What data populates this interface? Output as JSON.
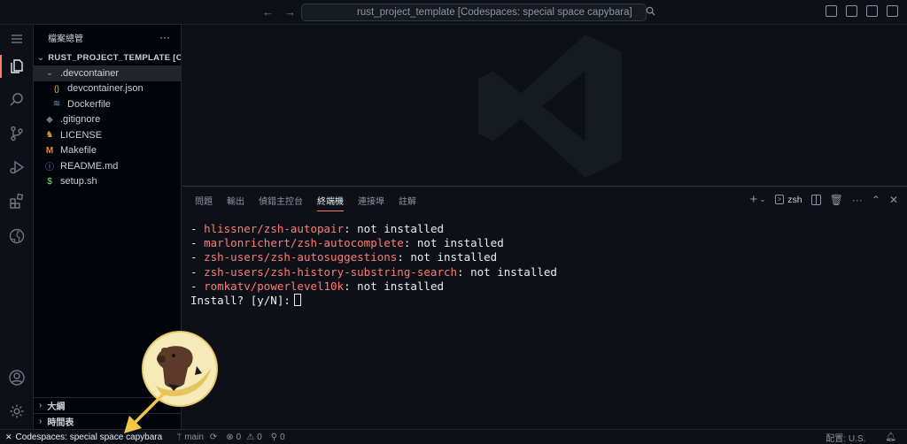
{
  "titlebar": {
    "search_text": "rust_project_template [Codespaces: special space capybara]",
    "back_icon": "arrow-left-icon",
    "forward_icon": "arrow-right-icon"
  },
  "sidebar": {
    "title": "檔案總管",
    "more": "···",
    "root": "RUST_PROJECT_TEMPLATE [C...",
    "items": [
      {
        "label": ".devcontainer",
        "icon": "chevron-down-icon",
        "glyph": "⌄",
        "color": "#8b949e"
      },
      {
        "label": "devcontainer.json",
        "icon": "json-icon",
        "glyph": "{}",
        "color": "#e3b341"
      },
      {
        "label": "Dockerfile",
        "icon": "docker-icon",
        "glyph": "🐳",
        "color": "#4aa3df"
      },
      {
        "label": ".gitignore",
        "icon": "git-icon",
        "glyph": "◆",
        "color": "#6e7681"
      },
      {
        "label": "LICENSE",
        "icon": "license-icon",
        "glyph": "♞",
        "color": "#d29922"
      },
      {
        "label": "Makefile",
        "icon": "makefile-icon",
        "glyph": "M",
        "color": "#f0883e"
      },
      {
        "label": "README.md",
        "icon": "info-icon",
        "glyph": "ⓘ",
        "color": "#58a6ff"
      },
      {
        "label": "setup.sh",
        "icon": "shell-icon",
        "glyph": "$",
        "color": "#7ee787"
      }
    ],
    "outline": "大綱",
    "timeline": "時間表"
  },
  "panel": {
    "tabs": [
      "問題",
      "輸出",
      "偵錯主控台",
      "終端機",
      "連接埠",
      "註解"
    ],
    "active_tab": 3,
    "terminal_name": "zsh",
    "lines": [
      {
        "prefix": "- ",
        "pkg": "hlissner/zsh-autopair",
        "suffix": ": not installed"
      },
      {
        "prefix": "- ",
        "pkg": "marlonrichert/zsh-autocomplete",
        "suffix": ": not installed"
      },
      {
        "prefix": "- ",
        "pkg": "zsh-users/zsh-autosuggestions",
        "suffix": ": not installed"
      },
      {
        "prefix": "- ",
        "pkg": "zsh-users/zsh-history-substring-search",
        "suffix": ": not installed"
      },
      {
        "prefix": "- ",
        "pkg": "romkatv/powerlevel10k",
        "suffix": ": not installed"
      }
    ],
    "prompt": "Install? [y/N]:"
  },
  "statusbar": {
    "remote": "Codespaces: special space capybara",
    "branch": "main",
    "errors": "0",
    "warnings": "0",
    "ports": "0",
    "layout": "配置: U.S."
  },
  "colors": {
    "accent": "#f78166",
    "package": "#ff7b72",
    "background": "#0d1117"
  }
}
